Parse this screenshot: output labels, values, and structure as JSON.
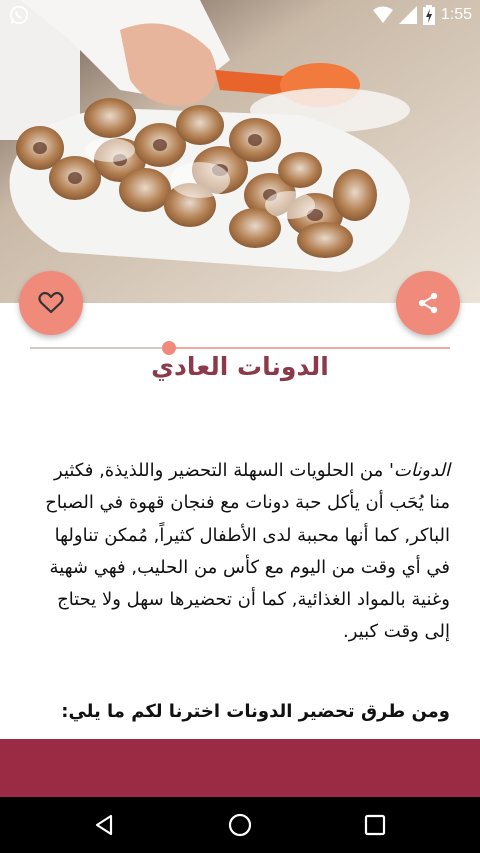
{
  "status_bar": {
    "time": "1:55",
    "icons": [
      "whatsapp-icon",
      "wifi-icon",
      "signal-icon",
      "battery-charging-icon"
    ]
  },
  "hero": {
    "image": "donuts-on-tray-photo"
  },
  "actions": {
    "favorite_icon": "heart-outline-icon",
    "share_icon": "share-icon"
  },
  "progress": {
    "fraction": 0.67
  },
  "article": {
    "title": "الدونات العادي",
    "intro_italic": "الدونات'",
    "intro_rest": " من الحلويات السهلة التحضير واللذيذة, فكثير منا يُحَب أن يأكل حبة دونات مع فنجان قهوة في الصباح الباكر, كما أنها محببة لدى الأطفال كثيراً, مُمكن تناولها في أي وقت من اليوم مع كأس من الحليب, فهي شهية وغنية بالمواد الغذائية, كما أن تحضيرها سهل ولا يحتاج إلى وقت كبير.",
    "subheading": "ومن طرق تحضير الدونات اخترنا لكم ما يلي:"
  },
  "colors": {
    "accent": "#f08a7b",
    "title": "#8b3a4b",
    "bottom_bar": "#9b2a45"
  },
  "nav": {
    "buttons": [
      "back-icon",
      "home-icon",
      "recents-icon"
    ]
  }
}
